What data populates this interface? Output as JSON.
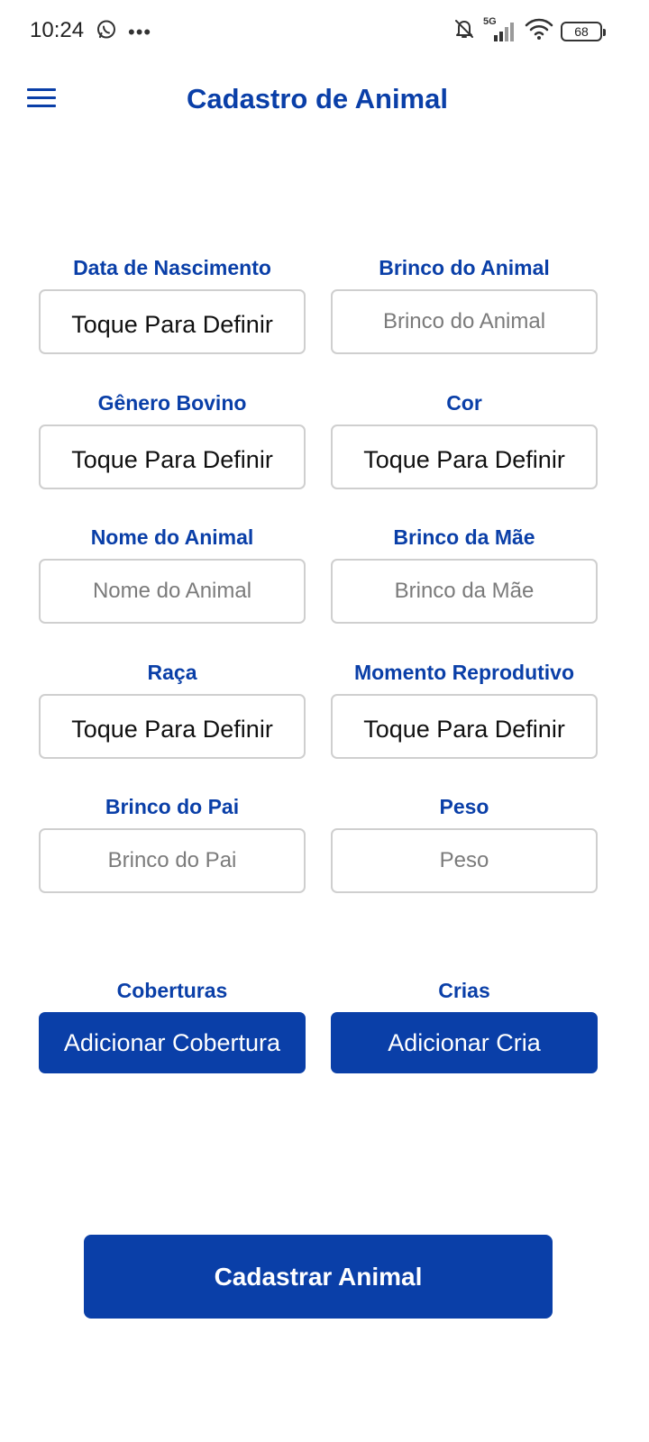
{
  "status_bar": {
    "time": "10:24",
    "network": "5G",
    "battery": "68"
  },
  "header": {
    "title": "Cadastro de Animal"
  },
  "form": {
    "birth_date": {
      "label": "Data de Nascimento",
      "value": "Toque Para Definir"
    },
    "animal_tag": {
      "label": "Brinco do Animal",
      "placeholder": "Brinco do Animal"
    },
    "gender": {
      "label": "Gênero Bovino",
      "value": "Toque Para Definir"
    },
    "color": {
      "label": "Cor",
      "value": "Toque Para Definir"
    },
    "animal_name": {
      "label": "Nome do Animal",
      "placeholder": "Nome do Animal"
    },
    "mother_tag": {
      "label": "Brinco da Mãe",
      "placeholder": "Brinco da Mãe"
    },
    "breed": {
      "label": "Raça",
      "value": "Toque Para Definir"
    },
    "reproductive_stage": {
      "label": "Momento Reprodutivo",
      "value": "Toque Para Definir"
    },
    "father_tag": {
      "label": "Brinco do Pai",
      "placeholder": "Brinco do Pai"
    },
    "weight": {
      "label": "Peso",
      "placeholder": "Peso"
    }
  },
  "coverings": {
    "label": "Coberturas",
    "button": "Adicionar Cobertura"
  },
  "offspring": {
    "label": "Crias",
    "button": "Adicionar Cria"
  },
  "submit_label": "Cadastrar Animal",
  "colors": {
    "accent": "#0a3fa8",
    "border": "#cfcfcf"
  }
}
